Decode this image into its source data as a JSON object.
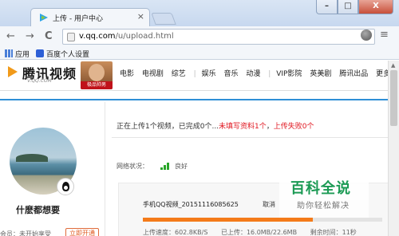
{
  "browser": {
    "tab_title": "上传 - 用户中心",
    "tab_close": "×",
    "url_host": "v.qq.com",
    "url_path": "/u/upload.html",
    "back_icon": "←",
    "forward_icon": "→",
    "reload_icon": "C",
    "star_icon": "☆",
    "wrench_icon": "🔧",
    "minimize": "–",
    "maximize": "□",
    "close": "X",
    "bookmarks": [
      {
        "label": "应用"
      },
      {
        "label": "百度个人设置"
      }
    ]
  },
  "site": {
    "logo_text": "腾讯视频",
    "logo_sub": "V.QQ.COM",
    "promo_label": "极品帅男",
    "nav": [
      "电影",
      "电视剧",
      "综艺",
      "娱乐",
      "音乐",
      "动漫",
      "VIP影院",
      "英美剧",
      "腾讯出品",
      "更多"
    ]
  },
  "profile": {
    "username": "什麽都想要",
    "member_text": "会员：未开始享受",
    "open_button": "立即开通"
  },
  "upload": {
    "status_prefix": "正在上传1个视频，已完成0个...",
    "status_unfilled": "未填写资料1个",
    "status_sep": "，",
    "status_failed": "上传失败0个",
    "network_label": "网络状况：",
    "network_status": "良好",
    "file_name": "手机QQ视频_20151116085625",
    "cancel_label": "取消",
    "progress": 0.71,
    "speed": "上传速度：602.8KB/S",
    "uploaded": "已上传：16.0MB/22.6MB",
    "remaining": "剩余时间：11秒"
  },
  "watermark": {
    "title": "百科全说",
    "subtitle": "助你轻松解决"
  },
  "colors": {
    "accent_blue": "#2f8fd6",
    "alert_red": "#e0141e",
    "progress_orange": "#f47b1a",
    "signal_green": "#2aa62a"
  }
}
